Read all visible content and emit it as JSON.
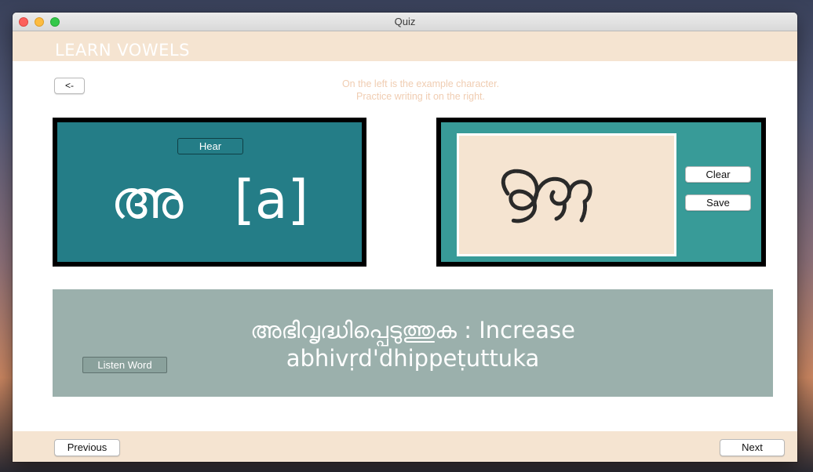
{
  "window": {
    "title": "Quiz"
  },
  "header": {
    "title": "LEARN VOWELS"
  },
  "nav": {
    "back_label": "<-"
  },
  "instructions": {
    "line1": "On the left is the example character.",
    "line2": "Practice writing it on the right."
  },
  "example": {
    "hear_label": "Hear",
    "character": "അ",
    "transliteration": "[a]"
  },
  "practice": {
    "clear_label": "Clear",
    "save_label": "Save"
  },
  "word": {
    "native": "അഭിവൃദ്ധിപ്പെടുത്തുക",
    "separator": ":",
    "meaning": "Increase",
    "romanized": "abhivṛd'dhippeṭuttuka",
    "listen_label": "Listen Word"
  },
  "footer": {
    "previous_label": "Previous",
    "next_label": "Next"
  },
  "colors": {
    "header_bg": "#f5e4d1",
    "example_panel": "#247d87",
    "practice_panel": "#389b98",
    "canvas_bg": "#f5e4d1",
    "word_band": "#9bb0ac",
    "instructions_text": "#f0cdb2"
  }
}
